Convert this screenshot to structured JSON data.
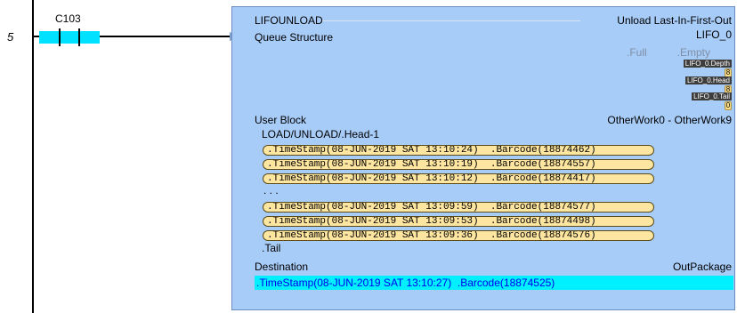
{
  "rung": {
    "number": "5"
  },
  "contact": {
    "label": "C103"
  },
  "block": {
    "title": "LIFOUNLOAD",
    "description": "Unload Last-In-First-Out",
    "instance": "LIFO_0",
    "queue_label": "Queue Structure",
    "full_label": ".Full",
    "empty_label": ".Empty",
    "status": [
      {
        "tag": "LIFO_0.Depth",
        "value": "8"
      },
      {
        "tag": "LIFO_0.Head",
        "value": "8"
      },
      {
        "tag": "LIFO_0.Tail",
        "value": "0"
      }
    ],
    "user_block_label": "User Block",
    "user_block_range": "OtherWork0 - OtherWork9",
    "user_block_sub": "LOAD/UNLOAD/.Head-1",
    "records": [
      ".TimeStamp(08-JUN-2019 SAT 13:10:24)  .Barcode(18874462)",
      ".TimeStamp(08-JUN-2019 SAT 13:10:19)  .Barcode(18874557)",
      ".TimeStamp(08-JUN-2019 SAT 13:10:12)  .Barcode(18874417)",
      ".TimeStamp(08-JUN-2019 SAT 13:09:59)  .Barcode(18874577)",
      ".TimeStamp(08-JUN-2019 SAT 13:09:53)  .Barcode(18874498)",
      ".TimeStamp(08-JUN-2019 SAT 13:09:36)  .Barcode(18874576)"
    ],
    "ellipsis": ". . .",
    "tail_label": ".Tail",
    "destination_label": "Destination",
    "destination_name": "OutPackage",
    "destination_value": ".TimeStamp(08-JUN-2019 SAT 13:10:27)  .Barcode(18874525)"
  },
  "colors": {
    "block_bg": "#a8ccf8",
    "contact_highlight": "#00e0ff",
    "destination_highlight": "#00f0ff",
    "record_fill": "#ffe6a0"
  }
}
